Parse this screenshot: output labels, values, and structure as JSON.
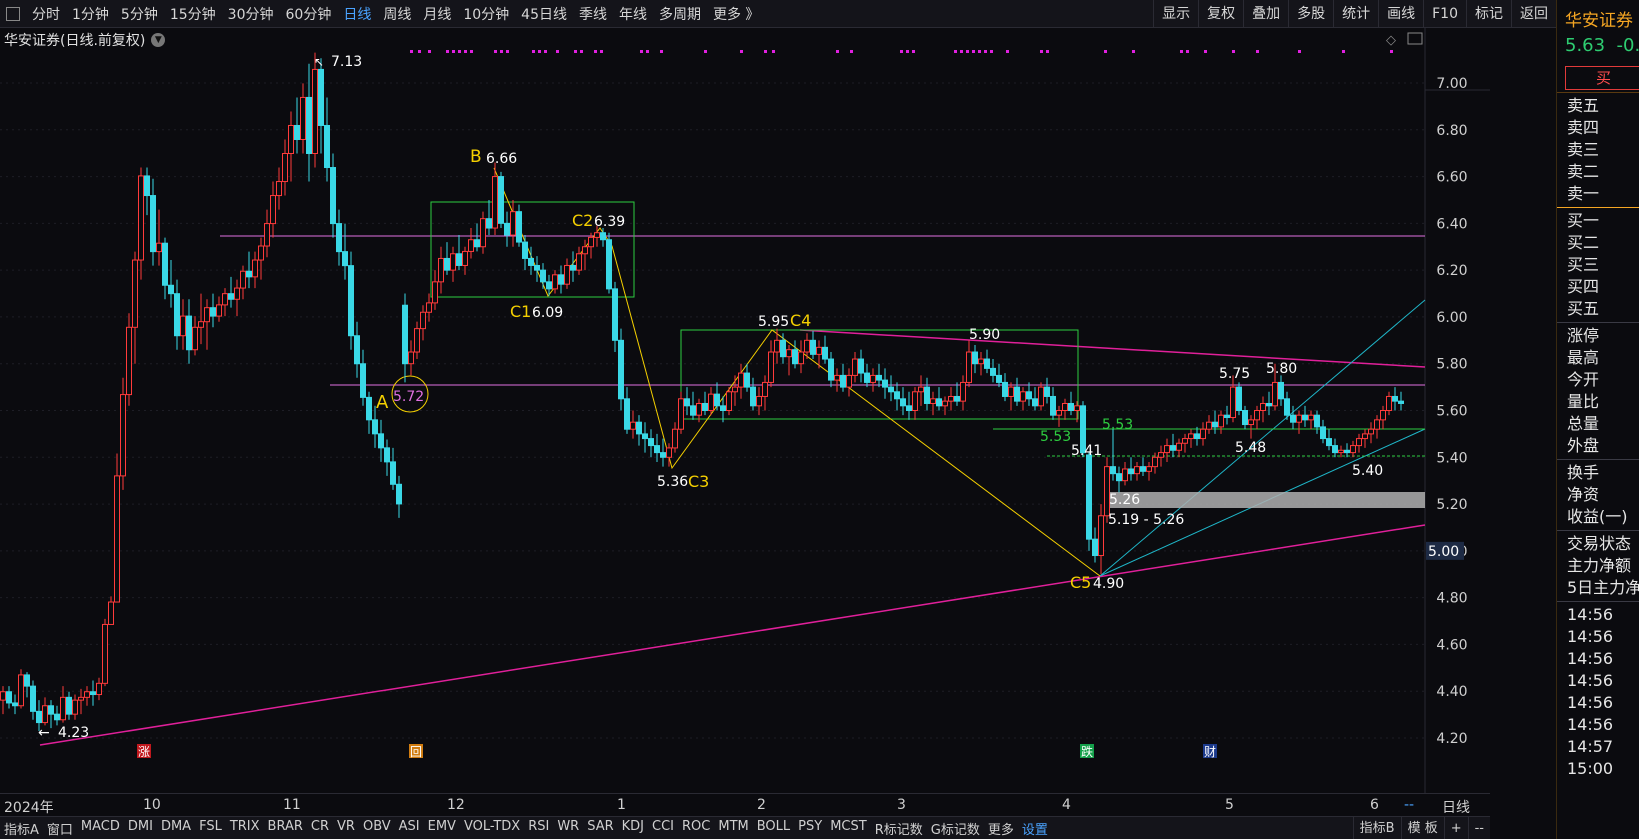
{
  "toolbar": {
    "periods": [
      "分时",
      "1分钟",
      "5分钟",
      "15分钟",
      "30分钟",
      "60分钟",
      "日线",
      "周线",
      "月线",
      "10分钟",
      "45日线",
      "季线",
      "年线",
      "多周期",
      "更多 》"
    ],
    "active_period": "日线",
    "right_items": [
      "显示",
      "复权",
      "叠加",
      "多股",
      "统计",
      "画线",
      "F10",
      "标记",
      "返回"
    ]
  },
  "chart_title": "华安证券(日线.前复权)",
  "price_axis": {
    "ticks": [
      "7.00",
      "6.80",
      "6.60",
      "6.40",
      "6.20",
      "6.00",
      "5.80",
      "5.60",
      "5.40",
      "5.20",
      "5.00",
      "4.80",
      "4.60",
      "4.40",
      "4.20"
    ],
    "current_tag": "5.00"
  },
  "x_axis": {
    "labels": [
      "2024年",
      "10",
      "11",
      "12",
      "1",
      "2",
      "3",
      "4",
      "5",
      "6"
    ],
    "right_label": "日线",
    "dashes": "--"
  },
  "annotations": {
    "high": "7.13",
    "low": "4.23",
    "A": "A",
    "A_val": "5.72",
    "B": "B",
    "B_val": "6.66",
    "C1": "C1",
    "C1_val": "6.09",
    "C2": "C2",
    "C2_val": "6.39",
    "C3": "C3",
    "C3_val": "5.36",
    "C4": "C4",
    "C4_val": "5.95",
    "C5": "C5",
    "C5_val": "4.90",
    "v590": "5.90",
    "v553a": "5.53",
    "v553b": "5.53",
    "v541": "5.41",
    "v526": "5.26",
    "range": "5.19 - 5.26",
    "v575": "5.75",
    "v580": "5.80",
    "v548": "5.48",
    "v540": "5.40"
  },
  "markers": {
    "zhang": "涨",
    "hui": "回",
    "die": "跌",
    "cai": "财"
  },
  "indicators": [
    "指标A",
    "窗口",
    "MACD",
    "DMI",
    "DMA",
    "FSL",
    "TRIX",
    "BRAR",
    "CR",
    "VR",
    "OBV",
    "ASI",
    "EMV",
    "VOL-TDX",
    "RSI",
    "WR",
    "SAR",
    "KDJ",
    "CCI",
    "ROC",
    "MTM",
    "BOLL",
    "PSY",
    "MCST",
    "R标记数",
    "G标记数",
    "更多",
    "设置"
  ],
  "bottom_right": [
    "指标B",
    "模 板",
    "+",
    "--"
  ],
  "right_panel": {
    "name": "华安证券",
    "price": "5.63",
    "change": "-0.",
    "buy": "买",
    "asks": [
      "卖五",
      "卖四",
      "卖三",
      "卖二",
      "卖一"
    ],
    "bids": [
      "买一",
      "买二",
      "买三",
      "买四",
      "买五"
    ],
    "stats": [
      "涨停",
      "最高",
      "今开",
      "量比",
      "总量",
      "外盘"
    ],
    "stats2": [
      "换手",
      "净资",
      "收益(一)"
    ],
    "status": [
      "交易状态",
      "主力净额",
      "5日主力净"
    ],
    "times": [
      "14:56",
      "14:56",
      "14:56",
      "14:56",
      "14:56",
      "14:56",
      "14:57",
      "15:00"
    ]
  },
  "colors": {
    "up": "#ff3b3b",
    "down": "#3ad8e6",
    "yellow": "#f5d000",
    "magenta": "#e0209a",
    "violet": "#e070e0",
    "green": "#2ecc40",
    "cyan": "#1fb6c8"
  }
}
